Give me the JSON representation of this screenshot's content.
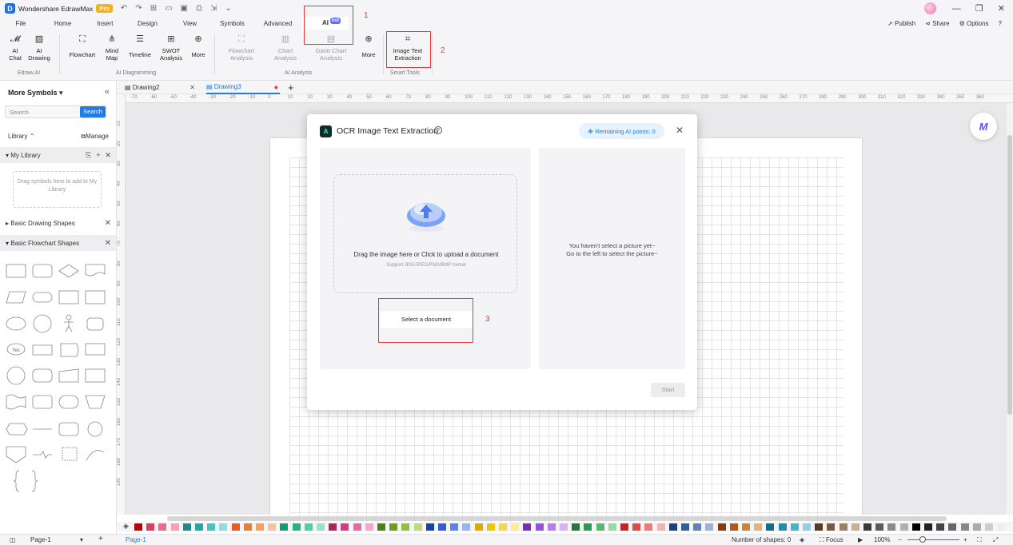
{
  "titlebar": {
    "app_name": "Wondershare EdrawMax",
    "badge": "Pro"
  },
  "menu": {
    "items": [
      "File",
      "Home",
      "Insert",
      "Design",
      "View",
      "Symbols",
      "Advanced",
      "AI"
    ],
    "hot_badge": "hot",
    "publish": "Publish",
    "share": "Share",
    "options": "Options"
  },
  "ribbon": {
    "ai_chat": "AI Chat",
    "ai_drawing": "AI Drawing",
    "group_edraw_ai": "Edraw AI",
    "flowchart": "Flowchart",
    "mind_map": "Mind Map",
    "timeline": "Timeline",
    "swot": "SWOT Analysis",
    "more1": "More",
    "group_ai_diagramming": "AI Diagramming",
    "flowchart_analysis": "Flowchart Analysis",
    "chart_analysis": "Chart Analysis",
    "gantt_analysis": "Gantt Chart Analysis",
    "more2": "More",
    "group_ai_analysis": "AI Analysis",
    "image_text": "Image Text Extraction",
    "group_smart_tools": "Smart Tools"
  },
  "annotations": {
    "n1": "1",
    "n2": "2",
    "n3": "3"
  },
  "sidebar": {
    "title": "More Symbols",
    "search_placeholder": "Search",
    "search_button": "Search",
    "library": "Library",
    "manage": "Manage",
    "my_library": "My Library",
    "drop_hint": "Drag symbols here to add to My Library",
    "basic_drawing": "Basic Drawing Shapes",
    "basic_flowchart": "Basic Flowchart Shapes"
  },
  "tabs": {
    "tab1": "Drawing2",
    "tab2": "Drawing3"
  },
  "ruler": {
    "h": [
      "-70",
      "-60",
      "-50",
      "-40",
      "-30",
      "-20",
      "-10",
      "0",
      "10",
      "20",
      "30",
      "40",
      "50",
      "60",
      "70",
      "80",
      "90",
      "100",
      "110",
      "120",
      "130",
      "140",
      "150",
      "160",
      "170",
      "180",
      "190",
      "200",
      "210",
      "220",
      "230",
      "240",
      "250",
      "260",
      "270",
      "280",
      "290",
      "300",
      "310",
      "320",
      "330",
      "340",
      "350",
      "360"
    ],
    "v": [
      "10",
      "20",
      "30",
      "40",
      "50",
      "60",
      "70",
      "80",
      "90",
      "100",
      "110",
      "120",
      "130",
      "140",
      "150",
      "160",
      "170",
      "180",
      "190"
    ]
  },
  "dialog": {
    "title": "OCR Image Text Extraction",
    "help": "?",
    "points": "Remaining AI points: 0",
    "upload_main": "Drag the image here or Click to upload a document",
    "upload_sub": "Support JPG/JPEG/PNG/BMP format",
    "select_button": "Select a document",
    "empty_line1": "You haven't select a picture yet~",
    "empty_line2": "Go to the left to select the picture~",
    "start_button": "Start"
  },
  "colors": [
    "#c00000",
    "#e03b5a",
    "#f06a8a",
    "#f7a1b5",
    "#1f8a8a",
    "#26a6a6",
    "#47c2c2",
    "#8fdddd",
    "#e85a1f",
    "#f07b2e",
    "#f59f5c",
    "#f9c39a",
    "#159b6e",
    "#21b583",
    "#52cfa0",
    "#98e3c7",
    "#b01f5e",
    "#d63a82",
    "#e56aa3",
    "#f1a8c9",
    "#4d7f17",
    "#6a9e23",
    "#8fbf3c",
    "#bcdc7c",
    "#1a3fb3",
    "#2f5fe0",
    "#5b83ee",
    "#9ab3f6",
    "#e0a800",
    "#f5c400",
    "#f8d84a",
    "#fbe99c",
    "#7a2fb3",
    "#9b4de0",
    "#b87eee",
    "#d6b3f6",
    "#1f7a3a",
    "#2c9a4a",
    "#55b86e",
    "#99d8a8",
    "#d11f1f",
    "#e84545",
    "#f07a7a",
    "#f6b0b0",
    "#1f3f7a",
    "#2f5fa0",
    "#5b83c0",
    "#9ab3dc",
    "#8a3a00",
    "#b05a1a",
    "#d08040",
    "#e8b080",
    "#0d6f8a",
    "#1a8fb0",
    "#4ab0cc",
    "#8fd0e3",
    "#5a3a1a",
    "#7a5a3a",
    "#a0805a",
    "#cbb090",
    "#3a3a3a",
    "#5a5a5a",
    "#8a8a8a",
    "#b0b0b0",
    "#000000",
    "#222222",
    "#444444",
    "#666666",
    "#888888",
    "#aaaaaa",
    "#cccccc",
    "#eeeeee"
  ],
  "status": {
    "page_select": "Page-1",
    "page_tab": "Page-1",
    "shapes": "Number of shapes: 0",
    "focus": "Focus",
    "zoom": "100%"
  }
}
